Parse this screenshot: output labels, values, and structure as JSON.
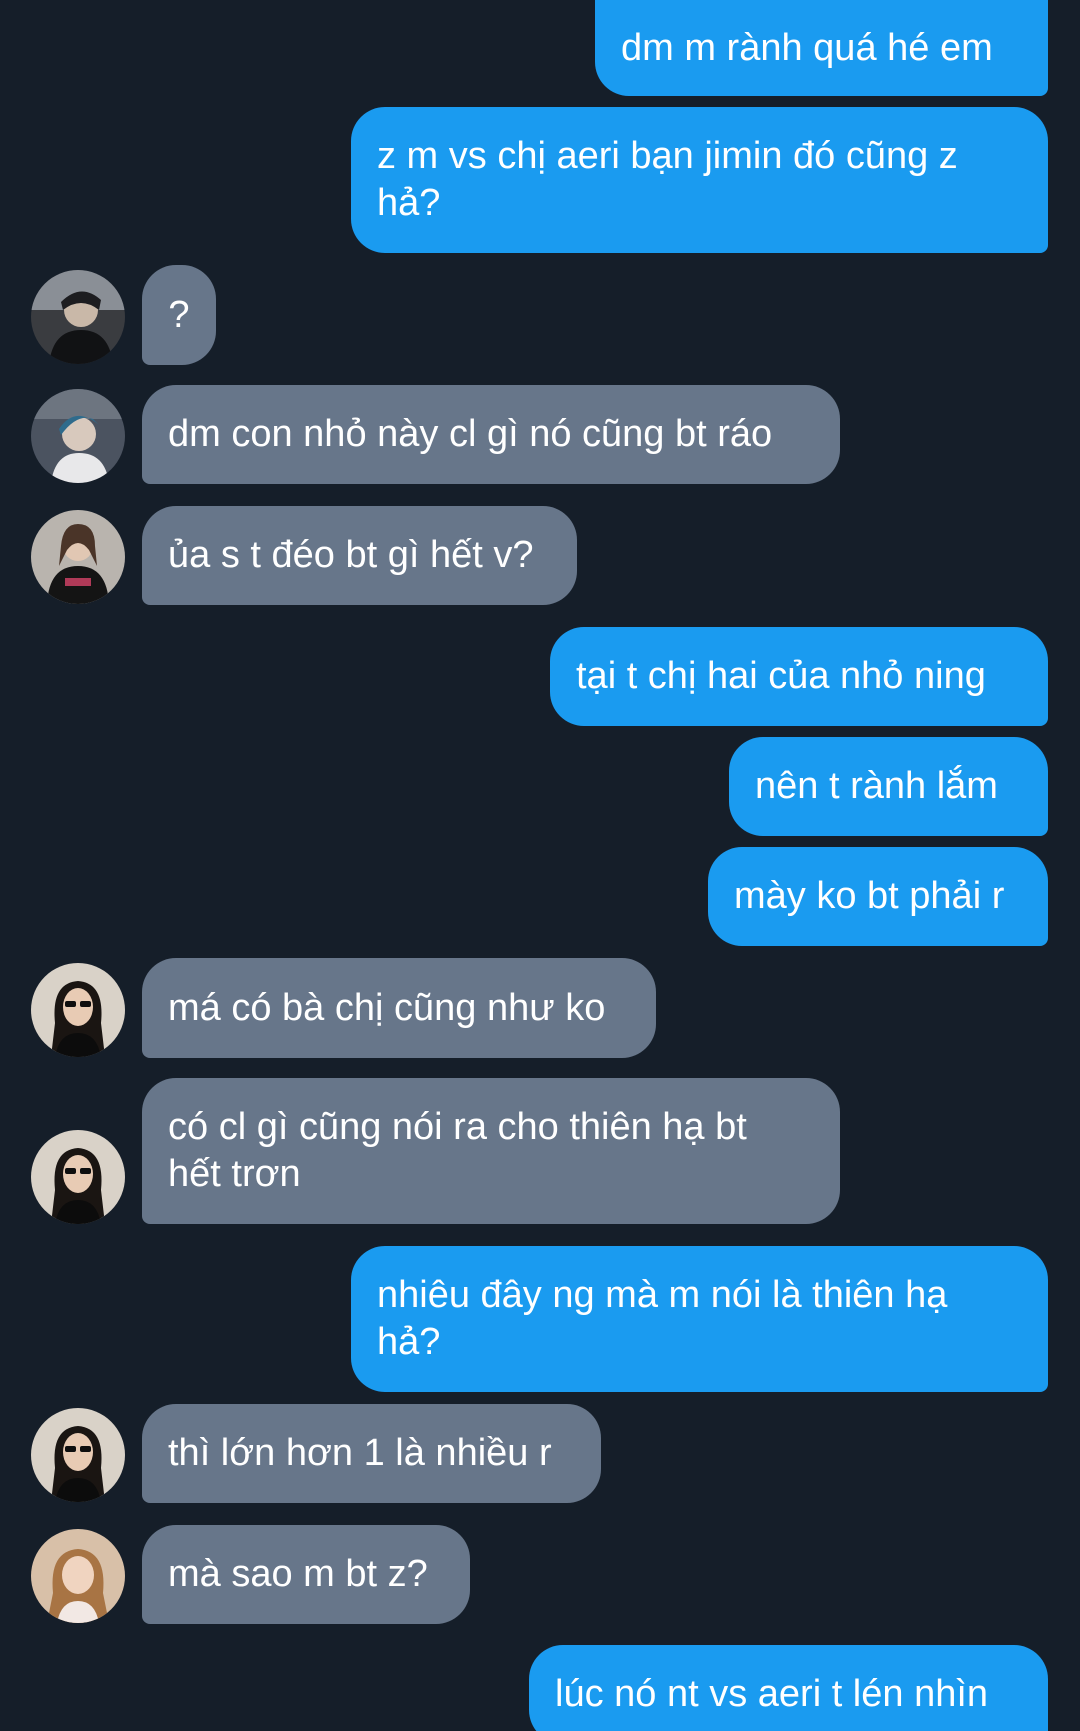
{
  "colors": {
    "background": "#151e29",
    "sent_bubble": "#1a9bf0",
    "received_bubble": "#67768a",
    "text": "#ffffff"
  },
  "messages": [
    {
      "side": "sent",
      "text": "dm m rành quá hé em"
    },
    {
      "side": "sent",
      "text": "z m vs chị aeri bạn jimin đó cũng z hả?"
    },
    {
      "side": "received",
      "text": "?",
      "avatar": "avatar-1"
    },
    {
      "side": "received",
      "text": "dm con nhỏ này cl gì nó cũng bt ráo",
      "avatar": "avatar-2"
    },
    {
      "side": "received",
      "text": "ủa s t đéo bt gì hết v?",
      "avatar": "avatar-3"
    },
    {
      "side": "sent",
      "text": "tại t chị hai của nhỏ ning"
    },
    {
      "side": "sent",
      "text": "nên t rành lắm"
    },
    {
      "side": "sent",
      "text": "mày ko bt phải r"
    },
    {
      "side": "received",
      "text": "má có bà chị cũng như ko",
      "avatar": "avatar-4"
    },
    {
      "side": "received",
      "text": "có cl gì cũng nói ra cho thiên hạ bt hết trơn",
      "avatar": "avatar-4"
    },
    {
      "side": "sent",
      "text": "nhiêu đây ng mà m nói là thiên hạ hả?"
    },
    {
      "side": "received",
      "text": "thì lớn hơn 1 là nhiều r",
      "avatar": "avatar-4"
    },
    {
      "side": "received",
      "text": "mà sao m bt z?",
      "avatar": "avatar-5"
    },
    {
      "side": "sent",
      "text": "lúc nó nt vs aeri t lén nhìn"
    }
  ]
}
